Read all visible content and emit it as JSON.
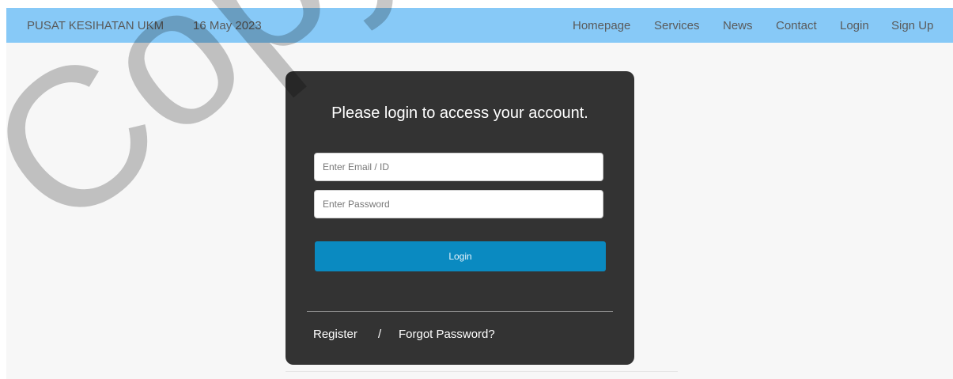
{
  "header": {
    "brand": "PUSAT KESIHATAN UKM",
    "date": "16 May 2023",
    "nav": [
      "Homepage",
      "Services",
      "News",
      "Contact",
      "Login",
      "Sign Up"
    ]
  },
  "login": {
    "title": "Please login to access your account.",
    "email_placeholder": "Enter Email / ID",
    "password_placeholder": "Enter Password",
    "button": "Login",
    "register": "Register",
    "separator": "/",
    "forgot": "Forgot Password?"
  },
  "watermark": "Copyright UKM",
  "colors": {
    "navbar": "#87c9f7",
    "panel": "#333333",
    "button": "#0a8ac1"
  }
}
